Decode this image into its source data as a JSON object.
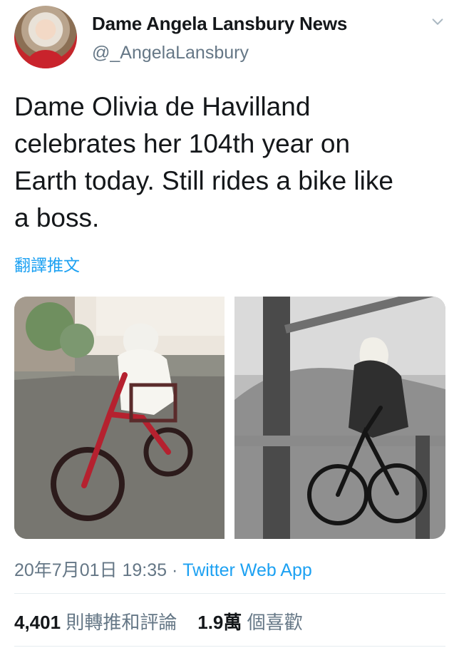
{
  "author": {
    "name": "Dame Angela Lansbury News",
    "handle": "@_AngelaLansbury",
    "avatar_icon": "person-avatar-icon"
  },
  "tweet": {
    "line1": "Dame Olivia de Havilland",
    "line2": "celebrates her 104th year on",
    "line3": "Earth today. Still rides a bike like",
    "line4": "a boss.",
    "translate_label": "翻譯推文"
  },
  "media": {
    "photo1_icon": "elderly-woman-riding-red-tricycle-photo",
    "photo2_icon": "woman-riding-bicycle-black-and-white-photo"
  },
  "meta": {
    "timestamp": "20年7月01日 19:35",
    "separator": "·",
    "source": "Twitter Web App"
  },
  "stats": {
    "retweets": "4,401",
    "retweets_label": "則轉推和評論",
    "likes": "1.9萬",
    "likes_label": "個喜歡"
  },
  "colors": {
    "blue": "#1DA1F2",
    "gray": "#657786",
    "text": "#14171A",
    "divider": "#E6ECF0"
  }
}
